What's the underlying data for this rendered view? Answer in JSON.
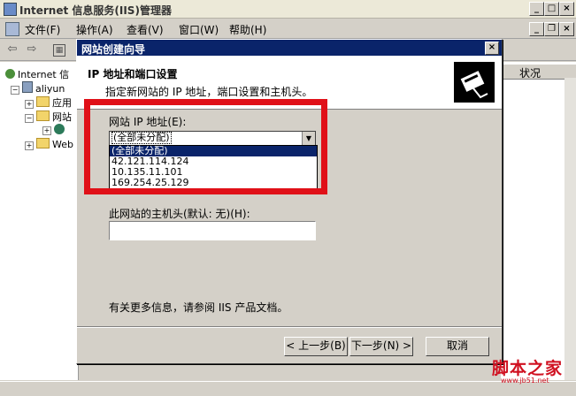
{
  "window": {
    "title": "Internet 信息服务(IIS)管理器"
  },
  "menu": [
    "文件(F)",
    "操作(A)",
    "查看(V)",
    "窗口(W)",
    "帮助(H)"
  ],
  "tree": {
    "root": "Internet 信",
    "server": "aliyun",
    "items": [
      "应用",
      "网站",
      "Web"
    ]
  },
  "list": {
    "column_header": "状况"
  },
  "dialog": {
    "title": "网站创建向导",
    "close": "×",
    "header_title": "IP 地址和端口设置",
    "header_subtitle": "指定新网站的 IP 地址，端口设置和主机头。",
    "ip_label": "网站 IP 地址(E):",
    "ip_selected": "(全部未分配)",
    "ip_options": [
      "(全部未分配)",
      "42.121.114.124",
      "10.135.11.101",
      "169.254.25.129"
    ],
    "host_label": "此网站的主机头(默认: 无)(H):",
    "host_value": "",
    "info_text": "有关更多信息，请参阅 IIS 产品文档。",
    "back_button": "< 上一步(B)",
    "next_button": "下一步(N) >",
    "cancel_button": "取消"
  },
  "watermark": {
    "text": "脚本之家",
    "url": "www.jb51.net"
  },
  "colors": {
    "title_bar": "#0a246a",
    "highlight": "#e01018",
    "face": "#d4d0c8"
  }
}
